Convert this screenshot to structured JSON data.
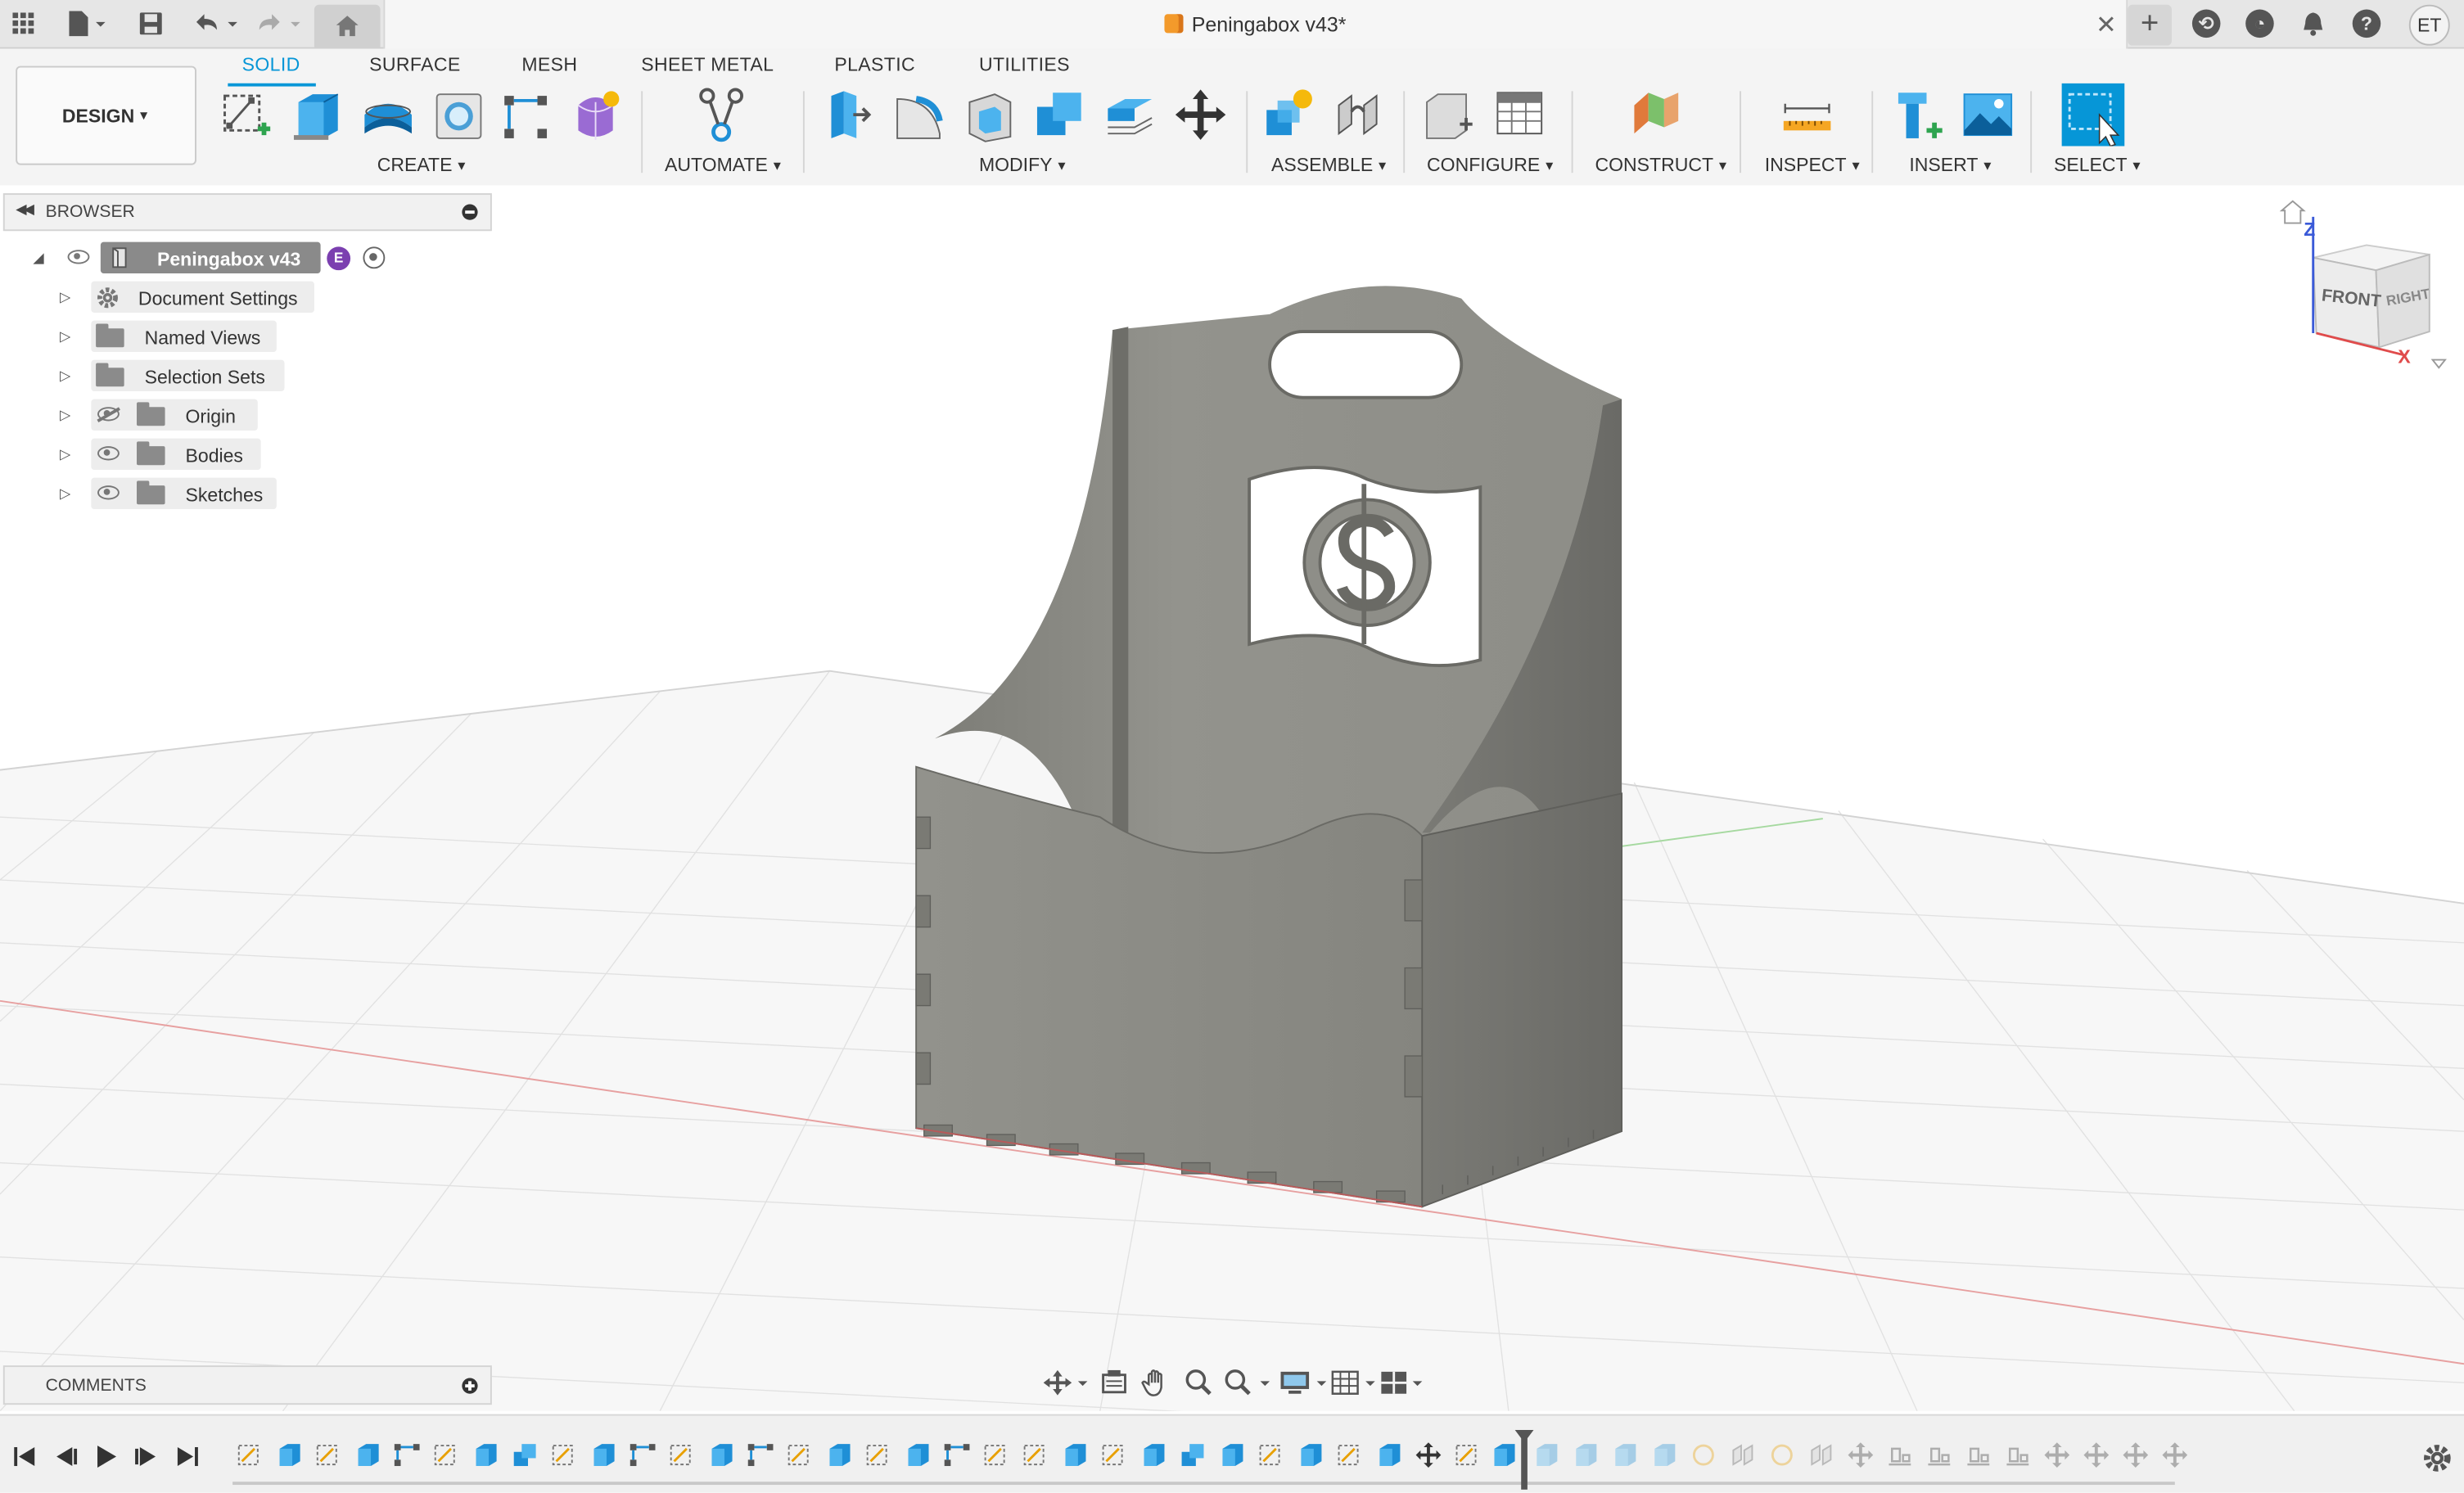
{
  "titlebar": {
    "document_title": "Peningabox v43*",
    "user_initials": "ET"
  },
  "toolbar": {
    "workspace_label": "DESIGN",
    "tabs": [
      "SOLID",
      "SURFACE",
      "MESH",
      "SHEET METAL",
      "PLASTIC",
      "UTILITIES"
    ],
    "active_tab": "SOLID",
    "groups": [
      "CREATE",
      "AUTOMATE",
      "MODIFY",
      "ASSEMBLE",
      "CONFIGURE",
      "CONSTRUCT",
      "INSPECT",
      "INSERT",
      "SELECT"
    ]
  },
  "browser": {
    "title": "BROWSER",
    "root": {
      "label": "Peningabox v43",
      "badge": "E"
    },
    "items": [
      {
        "label": "Document Settings",
        "icon": "gear-icon"
      },
      {
        "label": "Named Views",
        "icon": "folder-icon"
      },
      {
        "label": "Selection Sets",
        "icon": "folder-icon"
      },
      {
        "label": "Origin",
        "icon": "folder-icon",
        "visible": false
      },
      {
        "label": "Bodies",
        "icon": "folder-icon",
        "visible": true
      },
      {
        "label": "Sketches",
        "icon": "folder-icon",
        "visible": true
      }
    ]
  },
  "comments": {
    "title": "COMMENTS"
  },
  "viewcube": {
    "front": "FRONT",
    "right": "RIGHT",
    "z_axis": "Z",
    "x_axis": "X"
  },
  "colors": {
    "accent": "#0696d7",
    "model_face": "#8e8e88",
    "grid_line": "#dcdcdc",
    "x_axis": "#e06060",
    "y_axis": "#60c060"
  }
}
